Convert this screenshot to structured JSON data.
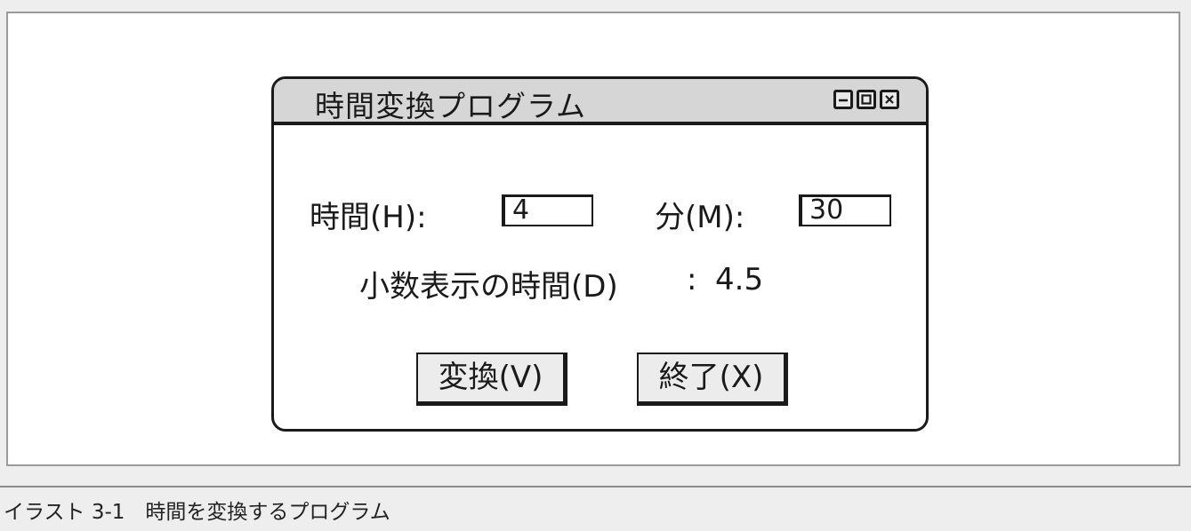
{
  "window": {
    "title": "時間変換プログラム",
    "controls": [
      "minimize-icon",
      "maximize-icon",
      "close-icon"
    ]
  },
  "form": {
    "hours_label": "時間(H):",
    "hours_value": "4",
    "minutes_label": "分(M):",
    "minutes_value": "30",
    "decimal_label": "小数表示の時間(D)",
    "decimal_separator": ":",
    "decimal_value": "4.5"
  },
  "buttons": {
    "convert_label": "変換(V)",
    "exit_label": "終了(X)"
  },
  "caption": {
    "text": "イラスト 3-1　時間を変換するプログラム"
  }
}
